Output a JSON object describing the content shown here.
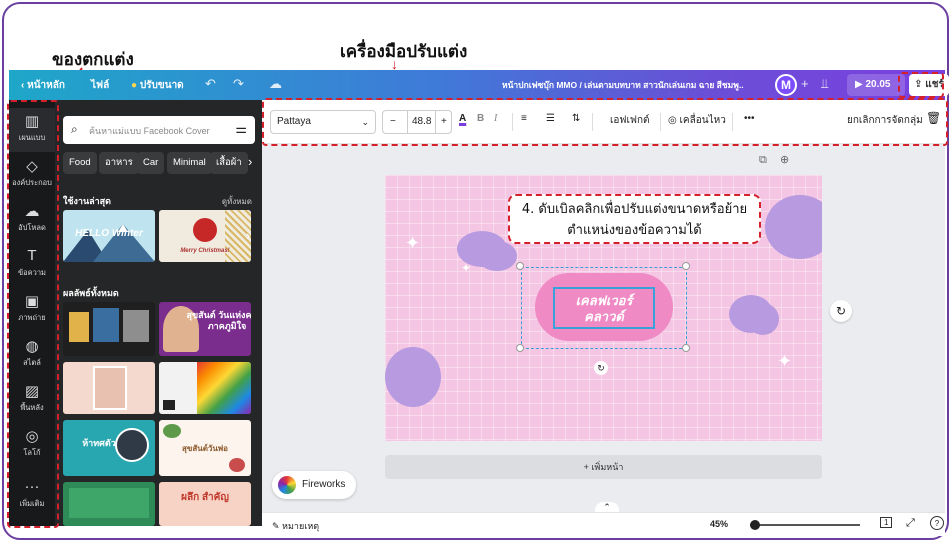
{
  "annotations": {
    "elements_label": "ของตกแต่ง",
    "tools_label": "เครื่องมือปรับแต่ง",
    "callout_line1": "4. ดับเบิลคลิกเพื่อปรับแต่งขนาดหรือย้าย",
    "callout_line2": "ตำแหน่งของข้อความได้"
  },
  "topbar": {
    "home": "หน้าหลัก",
    "file": "ไฟล์",
    "resize": "ปรับขนาด",
    "doc_title": "หน้าปกเฟซบุ๊ก MMO / เล่นตามบทบาท สาวนักเล่นเกม ฉาย สีชมพู..",
    "avatar": "M",
    "present": "20.05",
    "share": "แชร์"
  },
  "rail": [
    {
      "icon": "layout-icon",
      "label": "เผนแบบ"
    },
    {
      "icon": "elements-icon",
      "label": "องค์ประกอบ"
    },
    {
      "icon": "upload-icon",
      "label": "อัปโหลด"
    },
    {
      "icon": "text-icon",
      "label": "ข้อความ"
    },
    {
      "icon": "photos-icon",
      "label": "ภาพถ่าย"
    },
    {
      "icon": "styles-icon",
      "label": "สไตล์"
    },
    {
      "icon": "background-icon",
      "label": "พื้นหลัง"
    },
    {
      "icon": "logo-icon",
      "label": "โลโก้"
    },
    {
      "icon": "more-icon",
      "label": "เพิ่มเติม"
    }
  ],
  "panel": {
    "search_placeholder": "ค้นหาแม่แบบ Facebook Cover",
    "chips": [
      "Food",
      "อาหาร",
      "Car",
      "Minimal",
      "เสื้อผ้า"
    ],
    "recent_title": "ใช้งานล่าสุด",
    "see_all": "ดูทั้งหมด",
    "all_results_title": "ผลลัพธ์ทั้งหมด",
    "thumbs": {
      "recent1": "HELLO Winter",
      "recent2": "Merry Christmas!",
      "t2": "สุขสันต์ วันแห่งความ ภาคภูมิใจ",
      "t5": "ห้าทศตัว",
      "t6": "สุขสันต์วันพ่อ",
      "t8": "ผลึก สำคัญ"
    }
  },
  "toolbar": {
    "font": "Pattaya",
    "size": "48.8",
    "effects": "เอฟเฟกต์",
    "animate": "เคลื่อนไหว",
    "more": "•••",
    "ungroup": "ยกเลิกการจัดกลุ่ม"
  },
  "canvas": {
    "text_line1": "เคลฟเวอร์",
    "text_line2": "คลาวด์",
    "add_page": "+ เพิ่มหน้า",
    "fireworks": "Fireworks"
  },
  "status": {
    "notes": "หมายเหตุ",
    "zoom": "45%",
    "page_count": "1"
  }
}
